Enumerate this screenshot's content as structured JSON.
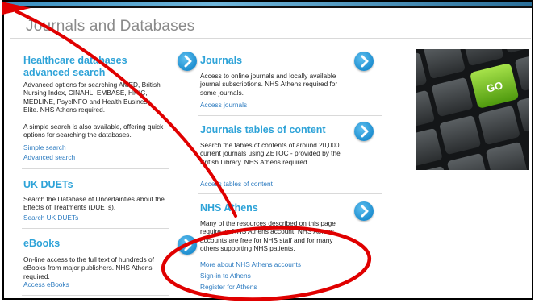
{
  "heading": "Journals and Databases",
  "left": {
    "healthcare": {
      "title": "Healthcare databases advanced search",
      "desc": "Advanced options for searching AMED, British Nursing Index, CINAHL, EMBASE, HMIC, MEDLINE, PsycINFO and Health Business Elite. NHS Athens required.",
      "desc2": "A simple search is also available, offering quick options for searching the databases.",
      "link_simple": "Simple search",
      "link_advanced": "Advanced search"
    },
    "duets": {
      "title": "UK DUETs",
      "desc": "Search the Database of Uncertainties about the Effects of Treatments (DUETs).",
      "link": "Search UK DUETs"
    },
    "ebooks": {
      "title": "eBooks",
      "desc": "On-line access to the full text of hundreds of eBooks from major publishers. NHS Athens required.",
      "link": "Access eBooks"
    }
  },
  "middle": {
    "journals": {
      "title": "Journals",
      "desc": "Access to online journals and locally available journal subscriptions. NHS Athens required for some journals.",
      "link": "Access journals"
    },
    "toc": {
      "title": "Journals tables of content",
      "desc": "Search the tables of contents of around 20,000 current journals using ZETOC - provided by the British Library. NHS Athens required.",
      "link": "Access tables of content"
    },
    "athens": {
      "title": "NHS Athens",
      "desc": "Many of the resources described on this page require an NHS Athens account. NHS Athens accounts are free for NHS staff and for many others supporting NHS patients.",
      "link_more": "More about NHS Athens accounts",
      "link_signin": "Sign-in to Athens",
      "link_register": "Register for Athens"
    }
  },
  "keyboard": {
    "key_label": "GO"
  },
  "colors": {
    "title": "#2ea3d8",
    "link": "#2c7bc0",
    "annotation": "#e00000",
    "go_key": "#7fc21a"
  }
}
